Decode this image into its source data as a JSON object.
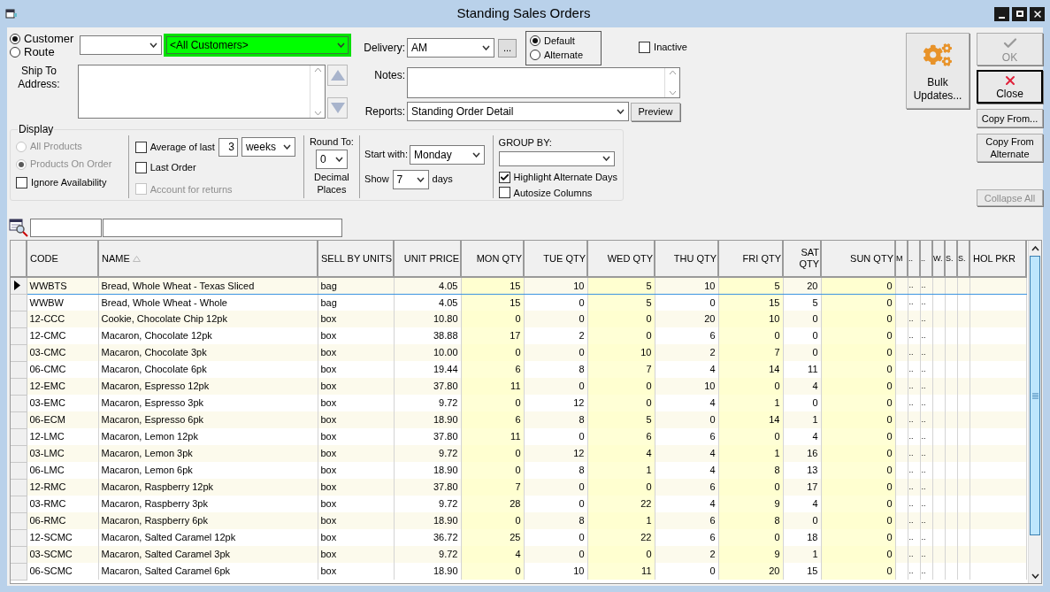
{
  "window": {
    "title": "Standing Sales Orders"
  },
  "mode_options": [
    {
      "label": "Customer",
      "selected": true
    },
    {
      "label": "Route",
      "selected": false
    }
  ],
  "customer": {
    "value": "<All Customers>"
  },
  "ship_to": {
    "label": "Ship To Address:"
  },
  "delivery": {
    "label": "Delivery:",
    "value": "AM",
    "more_button": "..."
  },
  "delivery_type": [
    {
      "label": "Default",
      "selected": true
    },
    {
      "label": "Alternate",
      "selected": false
    }
  ],
  "inactive": {
    "label": "Inactive",
    "checked": false
  },
  "notes": {
    "label": "Notes:"
  },
  "reports": {
    "label": "Reports:",
    "value": "Standing Order Detail",
    "button": "Preview"
  },
  "display": {
    "title": "Display",
    "product_options": [
      {
        "label": "All Products",
        "selected": false,
        "disabled": true
      },
      {
        "label": "Products On Order",
        "selected": true,
        "disabled": true
      }
    ],
    "ignore_availability": {
      "label": "Ignore Availability",
      "checked": false
    },
    "average": {
      "label": "Average of last",
      "checked": false,
      "count": "3",
      "unit": "weeks"
    },
    "last_order": {
      "label": "Last Order",
      "checked": false
    },
    "account_returns": {
      "label": "Account for returns",
      "checked": false,
      "disabled": true
    },
    "round_to": {
      "label": "Round To:",
      "value": "0",
      "caption": "Decimal Places"
    },
    "start_with": {
      "label": "Start with:",
      "value": "Monday"
    },
    "show": {
      "label": "Show",
      "value": "7",
      "unit": "days"
    },
    "group_by": {
      "label": "GROUP BY:"
    },
    "highlight_alternate": {
      "label": "Highlight Alternate Days",
      "checked": true
    },
    "autosize": {
      "label": "Autosize Columns",
      "checked": false
    }
  },
  "actions": {
    "bulk_updates": {
      "label": "Bulk Updates...",
      "disabled": false
    },
    "ok": {
      "label": "OK",
      "disabled": true
    },
    "close": {
      "label": "Close",
      "disabled": false
    },
    "copy_from": {
      "label": "Copy From...",
      "disabled": false
    },
    "copy_from_alternate": {
      "label": "Copy From Alternate",
      "disabled": false
    },
    "collapse_all": {
      "label": "Collapse All",
      "disabled": true
    }
  },
  "table": {
    "columns": [
      {
        "label": "CODE",
        "kind": "text",
        "sorted": false,
        "highlighted": false
      },
      {
        "label": "NAME",
        "kind": "text",
        "sorted": true,
        "highlighted": false
      },
      {
        "label": "SELL BY UNITS",
        "kind": "text",
        "sorted": false,
        "highlighted": false
      },
      {
        "label": "UNIT PRICE",
        "kind": "number",
        "sorted": false,
        "highlighted": false
      },
      {
        "label": "MON QTY",
        "kind": "number",
        "sorted": false,
        "highlighted": true
      },
      {
        "label": "TUE QTY",
        "kind": "number",
        "sorted": false,
        "highlighted": false
      },
      {
        "label": "WED QTY",
        "kind": "number",
        "sorted": false,
        "highlighted": true
      },
      {
        "label": "THU QTY",
        "kind": "number",
        "sorted": false,
        "highlighted": false
      },
      {
        "label": "FRI QTY",
        "kind": "number",
        "sorted": false,
        "highlighted": true
      },
      {
        "label": "SAT QTY",
        "kind": "number",
        "sorted": false,
        "highlighted": false
      },
      {
        "label": "SUN QTY",
        "kind": "number",
        "sorted": false,
        "highlighted": true
      },
      {
        "label": "M",
        "kind": "narrow",
        "sorted": false,
        "highlighted": false
      },
      {
        "label": "..",
        "kind": "narrow",
        "sorted": false,
        "highlighted": false
      },
      {
        "label": "..",
        "kind": "narrow",
        "sorted": false,
        "highlighted": false
      },
      {
        "label": "W.",
        "kind": "narrow",
        "sorted": false,
        "highlighted": false
      },
      {
        "label": "S.",
        "kind": "narrow",
        "sorted": false,
        "highlighted": false
      },
      {
        "label": "S.",
        "kind": "narrow",
        "sorted": false,
        "highlighted": false
      },
      {
        "label": "HOL PKR",
        "kind": "text",
        "sorted": false,
        "highlighted": false
      }
    ],
    "rows": [
      {
        "selected": true,
        "cells": [
          "WWBTS",
          "Bread, Whole Wheat - Texas Sliced",
          "bag",
          "4.05",
          "15",
          "10",
          "5",
          "10",
          "5",
          "20",
          "0",
          null,
          "..",
          "..",
          null,
          null,
          null,
          null
        ]
      },
      {
        "selected": false,
        "cells": [
          "WWBW",
          "Bread, Whole Wheat - Whole",
          "bag",
          "4.05",
          "15",
          "0",
          "5",
          "0",
          "15",
          "5",
          "0",
          null,
          "..",
          "..",
          null,
          null,
          null,
          null
        ]
      },
      {
        "selected": false,
        "cells": [
          "12-CCC",
          "Cookie, Chocolate Chip 12pk",
          "box",
          "10.80",
          "0",
          "0",
          "0",
          "20",
          "10",
          "0",
          "0",
          null,
          "..",
          "..",
          null,
          null,
          null,
          null
        ]
      },
      {
        "selected": false,
        "cells": [
          "12-CMC",
          "Macaron, Chocolate 12pk",
          "box",
          "38.88",
          "17",
          "2",
          "0",
          "6",
          "0",
          "0",
          "0",
          null,
          "..",
          "..",
          null,
          null,
          null,
          null
        ]
      },
      {
        "selected": false,
        "cells": [
          "03-CMC",
          "Macaron, Chocolate 3pk",
          "box",
          "10.00",
          "0",
          "0",
          "10",
          "2",
          "7",
          "0",
          "0",
          null,
          "..",
          "..",
          null,
          null,
          null,
          null
        ]
      },
      {
        "selected": false,
        "cells": [
          "06-CMC",
          "Macaron, Chocolate 6pk",
          "box",
          "19.44",
          "6",
          "8",
          "7",
          "4",
          "14",
          "11",
          "0",
          null,
          "..",
          "..",
          null,
          null,
          null,
          null
        ]
      },
      {
        "selected": false,
        "cells": [
          "12-EMC",
          "Macaron, Espresso 12pk",
          "box",
          "37.80",
          "11",
          "0",
          "0",
          "10",
          "0",
          "4",
          "0",
          null,
          "..",
          "..",
          null,
          null,
          null,
          null
        ]
      },
      {
        "selected": false,
        "cells": [
          "03-EMC",
          "Macaron, Espresso 3pk",
          "box",
          "9.72",
          "0",
          "12",
          "0",
          "4",
          "1",
          "0",
          "0",
          null,
          "..",
          "..",
          null,
          null,
          null,
          null
        ]
      },
      {
        "selected": false,
        "cells": [
          "06-ECM",
          "Macaron, Espresso 6pk",
          "box",
          "18.90",
          "6",
          "8",
          "5",
          "0",
          "14",
          "1",
          "0",
          null,
          "..",
          "..",
          null,
          null,
          null,
          null
        ]
      },
      {
        "selected": false,
        "cells": [
          "12-LMC",
          "Macaron, Lemon 12pk",
          "box",
          "37.80",
          "11",
          "0",
          "6",
          "6",
          "0",
          "4",
          "0",
          null,
          "..",
          "..",
          null,
          null,
          null,
          null
        ]
      },
      {
        "selected": false,
        "cells": [
          "03-LMC",
          "Macaron, Lemon 3pk",
          "box",
          "9.72",
          "0",
          "12",
          "4",
          "4",
          "1",
          "16",
          "0",
          null,
          "..",
          "..",
          null,
          null,
          null,
          null
        ]
      },
      {
        "selected": false,
        "cells": [
          "06-LMC",
          "Macaron, Lemon 6pk",
          "box",
          "18.90",
          "0",
          "8",
          "1",
          "4",
          "8",
          "13",
          "0",
          null,
          "..",
          "..",
          null,
          null,
          null,
          null
        ]
      },
      {
        "selected": false,
        "cells": [
          "12-RMC",
          "Macaron, Raspberry 12pk",
          "box",
          "37.80",
          "7",
          "0",
          "0",
          "6",
          "0",
          "17",
          "0",
          null,
          "..",
          "..",
          null,
          null,
          null,
          null
        ]
      },
      {
        "selected": false,
        "cells": [
          "03-RMC",
          "Macaron, Raspberry 3pk",
          "box",
          "9.72",
          "28",
          "0",
          "22",
          "4",
          "9",
          "4",
          "0",
          null,
          "..",
          "..",
          null,
          null,
          null,
          null
        ]
      },
      {
        "selected": false,
        "cells": [
          "06-RMC",
          "Macaron, Raspberry 6pk",
          "box",
          "18.90",
          "0",
          "8",
          "1",
          "6",
          "8",
          "0",
          "0",
          null,
          "..",
          "..",
          null,
          null,
          null,
          null
        ]
      },
      {
        "selected": false,
        "cells": [
          "12-SCMC",
          "Macaron, Salted Caramel 12pk",
          "box",
          "36.72",
          "25",
          "0",
          "22",
          "6",
          "0",
          "18",
          "0",
          null,
          "..",
          "..",
          null,
          null,
          null,
          null
        ]
      },
      {
        "selected": false,
        "cells": [
          "03-SCMC",
          "Macaron, Salted Caramel 3pk",
          "box",
          "9.72",
          "4",
          "0",
          "0",
          "2",
          "9",
          "1",
          "0",
          null,
          "..",
          "..",
          null,
          null,
          null,
          null
        ]
      },
      {
        "selected": false,
        "cells": [
          "06-SCMC",
          "Macaron, Salted Caramel 6pk",
          "box",
          "18.90",
          "0",
          "10",
          "11",
          "0",
          "20",
          "15",
          "0",
          null,
          "..",
          "..",
          null,
          null,
          null,
          null
        ]
      }
    ]
  }
}
